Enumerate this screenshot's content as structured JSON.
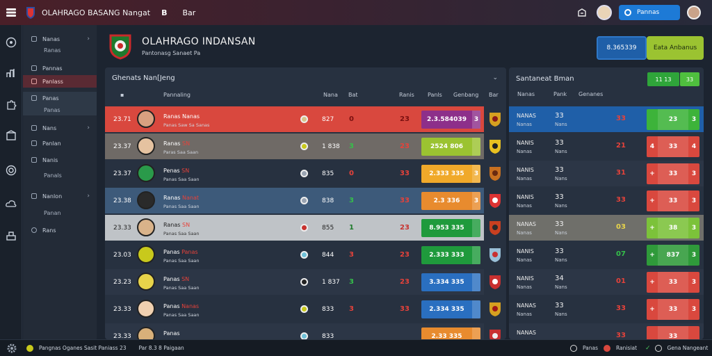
{
  "app": {
    "title": "OLAHRAGO BASANG Nangat",
    "b_label": "B",
    "bell_label": "Bar",
    "account_button": "Pannas"
  },
  "colors": {
    "brand_red": "#c8322f",
    "accent_blue": "#1d7ad6",
    "accent_green": "#9bc331",
    "row_red": "#d9483e",
    "row_blue": "#3d5a7a"
  },
  "sidebar": {
    "items": [
      {
        "label": "Nanas",
        "icon": "home-icon",
        "chevron": true
      },
      {
        "label": "Ranas",
        "icon": "",
        "chevron": false
      },
      {
        "label": "Pannas",
        "icon": "chart-icon",
        "chevron": false
      },
      {
        "label": "Panlass",
        "icon": "",
        "chevron": false,
        "active": true
      },
      {
        "label": "Panas",
        "icon": "home-icon",
        "chevron": false,
        "highlight": true
      },
      {
        "label": "Panas",
        "icon": "",
        "chevron": false,
        "highlight": true
      },
      {
        "label": "Nans",
        "icon": "box-icon",
        "chevron": true
      },
      {
        "label": "Panlan",
        "icon": "box-icon",
        "chevron": false
      },
      {
        "label": "Nanis",
        "icon": "box-icon",
        "chevron": false
      },
      {
        "label": "Panals",
        "icon": "",
        "chevron": false
      },
      {
        "label": "Nanlon",
        "icon": "box-icon",
        "chevron": true
      },
      {
        "label": "Panan",
        "icon": "",
        "chevron": false
      },
      {
        "label": "Rans",
        "icon": "person-icon",
        "chevron": false
      }
    ]
  },
  "header": {
    "title": "OLAHRAGO INDANSAN",
    "subtitle": "Pantonasg Sanaet Pa",
    "button1": "8.365339",
    "button2": "Eata Anbanus"
  },
  "left_panel": {
    "title": "Ghenats Nan[Jeng",
    "columns": [
      "Pannaling",
      "Nana",
      "Bat",
      "Ranis",
      "Panls",
      "Genbang",
      "Bar"
    ],
    "rows": [
      {
        "rank": "23.71",
        "name": "Ranas",
        "name_hl": "Nanas",
        "sub": "Panas Saw Sa Sanas",
        "val": "827",
        "n1": "0",
        "n2": "23",
        "bar": "2.3.584039",
        "bar_end": "3",
        "theme": "red"
      },
      {
        "rank": "23.37",
        "name": "Ranas",
        "name_hl": "SN",
        "sub": "Paras Saa Saan",
        "val": "1 838",
        "n1": "3",
        "n2": "23",
        "bar": "2524 806",
        "bar_end": "",
        "theme": "grey"
      },
      {
        "rank": "23.37",
        "name": "Penas",
        "name_hl": "SN",
        "sub": "Panas Saa Saan",
        "val": "835",
        "n1": "0",
        "n2": "33",
        "bar": "2.333 335",
        "bar_end": "3",
        "theme": "dark"
      },
      {
        "rank": "23.38",
        "name": "Ranas",
        "name_hl": "Nanat",
        "sub": "Panas Saa Saan",
        "val": "838",
        "n1": "3",
        "n2": "33",
        "bar": "2.3 336",
        "bar_end": "3",
        "theme": "blue"
      },
      {
        "rank": "23.33",
        "name": "Ranas",
        "name_hl": "SN",
        "sub": "Panas Saa Saan",
        "val": "855",
        "n1": "1",
        "n2": "23",
        "bar": "8.953 335",
        "bar_end": "",
        "theme": "light"
      },
      {
        "rank": "23.03",
        "name": "Panas",
        "name_hl": "Panas",
        "sub": "Panas Saa Saan",
        "val": "844",
        "n1": "3",
        "n2": "23",
        "bar": "2.333 333",
        "bar_end": "",
        "theme": "dark"
      },
      {
        "rank": "23.23",
        "name": "Panas",
        "name_hl": "SN",
        "sub": "Panas Saa Saan",
        "val": "1 837",
        "n1": "3",
        "n2": "23",
        "bar": "3.334 335",
        "bar_end": "",
        "theme": "dark2"
      },
      {
        "rank": "23.33",
        "name": "Panas",
        "name_hl": "Nanas",
        "sub": "Panas Saa Saan",
        "val": "833",
        "n1": "3",
        "n2": "33",
        "bar": "2.334 335",
        "bar_end": "",
        "theme": "dark"
      },
      {
        "rank": "23.33",
        "name": "Panas",
        "name_hl": "",
        "sub": "",
        "val": "833",
        "n1": "",
        "n2": "",
        "bar": "2.33 335",
        "bar_end": "",
        "theme": "dark2"
      }
    ]
  },
  "right_panel": {
    "title": "Santaneat Bman",
    "top_buttons": [
      "11 13",
      "33"
    ],
    "columns": [
      "Nanas",
      "Pank",
      "Genanes"
    ],
    "rows": [
      {
        "a": "NANAS",
        "b": "Nanas",
        "c": "33",
        "d": "Nans",
        "e": "33",
        "box": "23",
        "left": "",
        "right": "3",
        "theme": "blue"
      },
      {
        "a": "NANIS",
        "b": "Nanas",
        "c": "33",
        "d": "Nans",
        "e": "21",
        "box": "33",
        "left": "4",
        "right": "4",
        "theme": "dark"
      },
      {
        "a": "NANIS",
        "b": "Nanas",
        "c": "33",
        "d": "Nans",
        "e": "31",
        "box": "33",
        "left": "+",
        "right": "3",
        "theme": "dark2"
      },
      {
        "a": "NANIS",
        "b": "Nanas",
        "c": "33",
        "d": "Nans",
        "e": "33",
        "box": "33",
        "left": "+",
        "right": "3",
        "theme": "dark"
      },
      {
        "a": "NANAS",
        "b": "Nanas",
        "c": "33",
        "d": "Nans",
        "e": "03",
        "box": "38",
        "left": "+",
        "right": "3",
        "theme": "light"
      },
      {
        "a": "NANIS",
        "b": "Nanas",
        "c": "33",
        "d": "Nans",
        "e": "07",
        "box": "837",
        "left": "+",
        "right": "3",
        "theme": "dark"
      },
      {
        "a": "NANIS",
        "b": "Nanas",
        "c": "34",
        "d": "Nans",
        "e": "01",
        "box": "33",
        "left": "+",
        "right": "3",
        "theme": "dark2"
      },
      {
        "a": "NANAS",
        "b": "Nanas",
        "c": "33",
        "d": "Nans",
        "e": "33",
        "box": "33",
        "left": "+",
        "right": "3",
        "theme": "dark"
      },
      {
        "a": "NANAS",
        "b": "",
        "c": "",
        "d": "",
        "e": "33",
        "box": "33",
        "left": "",
        "right": "",
        "theme": "dark2"
      }
    ]
  },
  "status": {
    "left1": "Pangnas Oganes Sasit Paniass 23",
    "left2": "Par 8.3 8 Paigaan",
    "right1": "Panas",
    "right2": "Ranisiat",
    "right3": "Gena Nangeant"
  }
}
